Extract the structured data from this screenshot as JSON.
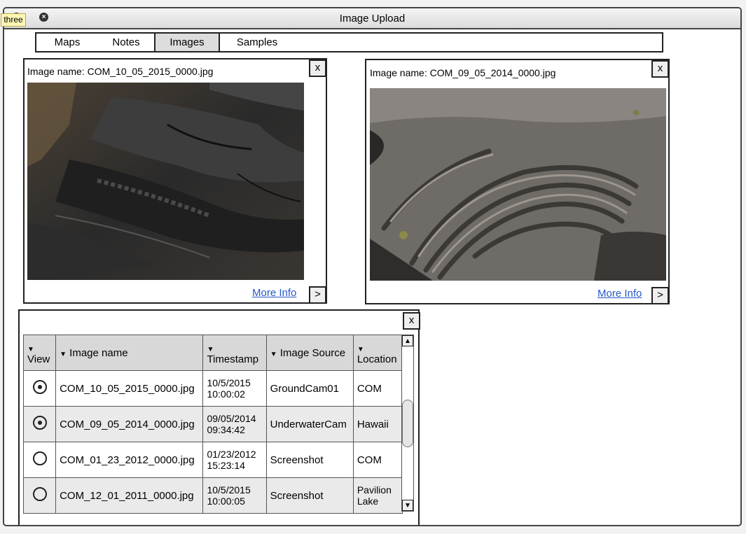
{
  "window": {
    "title": "Image Upload",
    "tooltip": "three",
    "minimize_glyph": "–",
    "close_glyph": "×"
  },
  "tabs": [
    {
      "label": "Maps",
      "active": false
    },
    {
      "label": "Notes",
      "active": false
    },
    {
      "label": "Images",
      "active": true
    },
    {
      "label": "Samples",
      "active": false
    }
  ],
  "panels": [
    {
      "name_label": "Image name: COM_10_05_2015_0000.jpg",
      "close": "x",
      "more_info": "More Info",
      "next": ">",
      "photo": "dark lava rock surface"
    },
    {
      "name_label": "Image name: COM_09_05_2014_0000.jpg",
      "close": "x",
      "more_info": "More Info",
      "next": ">",
      "photo": "ropy pahoehoe lava flow"
    }
  ],
  "table": {
    "close": "x",
    "sort_glyph": "▼",
    "headers": [
      "View",
      "Image name",
      "Timestamp",
      "Image Source",
      "Location"
    ],
    "rows": [
      {
        "selected": true,
        "name": "COM_10_05_2015_0000.jpg",
        "date": "10/5/2015",
        "time": "10:00:02",
        "source": "GroundCam01",
        "location": "COM"
      },
      {
        "selected": true,
        "name": "COM_09_05_2014_0000.jpg",
        "date": "09/05/2014",
        "time": "09:34:42",
        "source": "UnderwaterCam",
        "location": "Hawaii"
      },
      {
        "selected": false,
        "name": "COM_01_23_2012_0000.jpg",
        "date": "01/23/2012",
        "time": "15:23:14",
        "source": "Screenshot",
        "location": "COM"
      },
      {
        "selected": false,
        "name": "COM_12_01_2011_0000.jpg",
        "date": "10/5/2015",
        "time": "10:00:05",
        "source": "Screenshot",
        "location": "Pavilion Lake"
      }
    ],
    "scroll_up": "▲",
    "scroll_down": "▼"
  },
  "colors": {
    "link": "#2557c9",
    "tooltip_bg": "#fdf6b5"
  }
}
